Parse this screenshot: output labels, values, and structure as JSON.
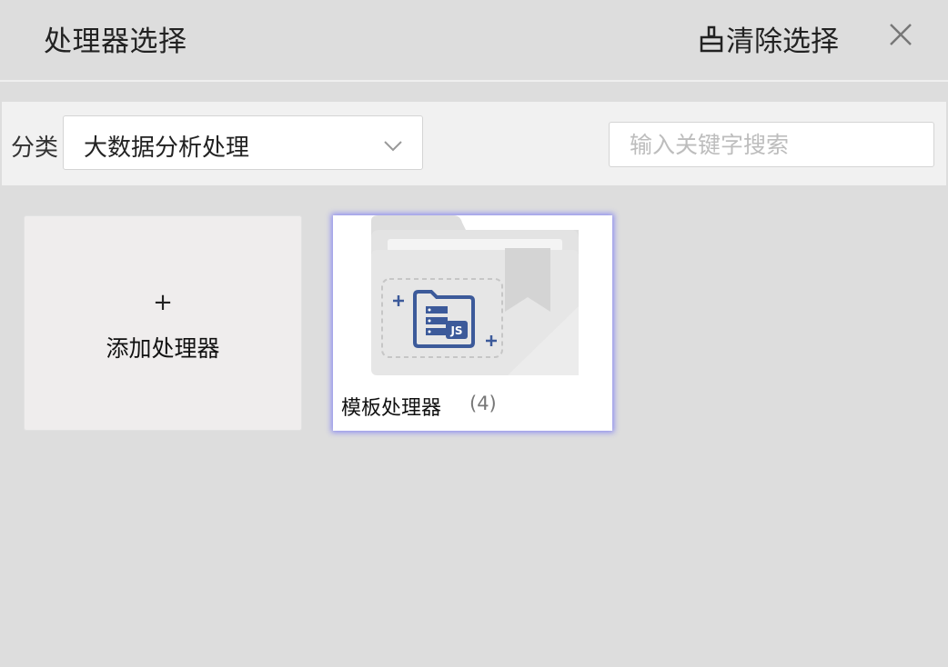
{
  "header": {
    "title": "处理器选择",
    "clear_label": "清除选择"
  },
  "filter": {
    "category_label": "分类",
    "category_value": "大数据分析处理",
    "search_placeholder": "输入关键字搜索",
    "search_value": ""
  },
  "cards": {
    "add": {
      "plus": "+",
      "label": "添加处理器"
    },
    "items": [
      {
        "name": "模板处理器",
        "count": "(4)",
        "icon": "js-folder-icon"
      }
    ]
  },
  "colors": {
    "background": "#dddddd",
    "filterbar": "#f1f1f1",
    "selected_glow": "#8f8ff0",
    "icon_blue": "#3c5a9a"
  }
}
